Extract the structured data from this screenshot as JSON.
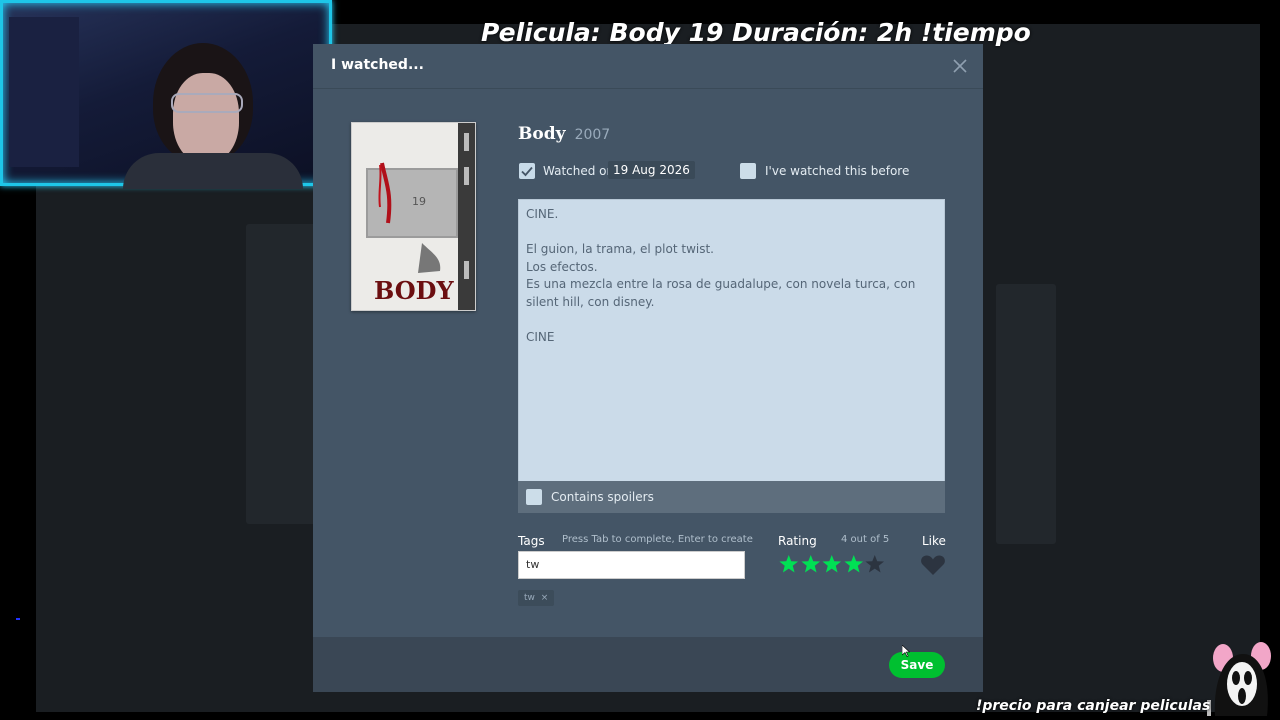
{
  "overlay": {
    "title": "Pelicula: Body 19 Duración: 2h  !tiempo",
    "bottom_text": "!precio para canjear peliculas"
  },
  "modal": {
    "title": "I watched...",
    "close_icon": "close-icon"
  },
  "film": {
    "title": "Body",
    "year": "2007",
    "poster_text": "BODY",
    "poster_number": "19"
  },
  "watched": {
    "checked": true,
    "label": "Watched on",
    "date": "19 Aug 2026",
    "rewatch_label": "I've watched this before",
    "rewatch_checked": false
  },
  "review": {
    "text": "CINE.\n\nEl guion, la trama, el plot twist.\nLos efectos.\nEs una mezcla entre la rosa de guadalupe, con novela turca, con silent hill, con disney.\n\nCINE",
    "spoiler_label": "Contains spoilers",
    "spoiler_checked": false
  },
  "tags": {
    "label": "Tags",
    "hint": "Press Tab to complete, Enter to create",
    "input_value": "tw",
    "chips": [
      {
        "text": "tw",
        "remove": "×"
      }
    ]
  },
  "rating": {
    "label": "Rating",
    "value_text": "4 out of 5",
    "value": 4,
    "max": 5,
    "filled_color": "#00e054",
    "empty_color": "#2c3440"
  },
  "like": {
    "label": "Like",
    "liked": false
  },
  "footer": {
    "save_label": "Save"
  },
  "colors": {
    "modal_bg": "#445566",
    "save_green": "#00c030"
  }
}
